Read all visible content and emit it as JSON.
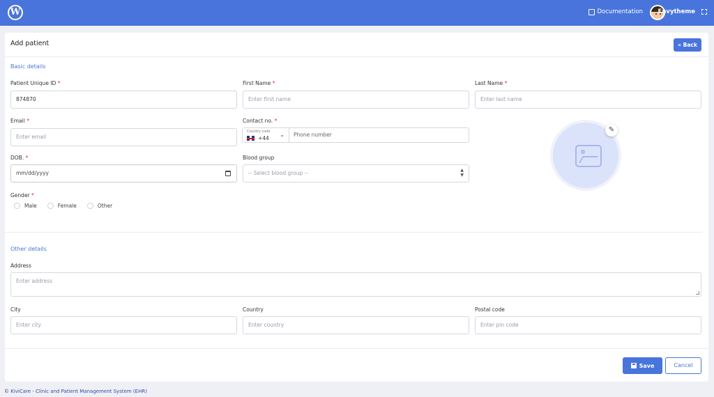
{
  "topbar": {
    "logo_text": "W",
    "documentation_label": "Documentation",
    "username": "Envytheme"
  },
  "card": {
    "title": "Add patient",
    "back_label": "Back"
  },
  "basic": {
    "section_title": "Basic details",
    "patient_id": {
      "label": "Patient Unique ID",
      "value": "874870"
    },
    "first_name": {
      "label": "First Name",
      "placeholder": "Enter first name"
    },
    "last_name": {
      "label": "Last Name",
      "placeholder": "Enter last name"
    },
    "email": {
      "label": "Email",
      "placeholder": "Enter email"
    },
    "contact": {
      "label": "Contact no.",
      "country_code_caption": "Country code",
      "country_code": "+44",
      "phone_placeholder": "Phone number"
    },
    "dob": {
      "label": "DOB.",
      "placeholder": "mm/dd/yyyy"
    },
    "blood_group": {
      "label": "Blood group",
      "placeholder": "-- Select blood group --"
    },
    "gender": {
      "label": "Gender",
      "options": [
        "Male",
        "Female",
        "Other"
      ]
    }
  },
  "other": {
    "section_title": "Other details",
    "address": {
      "label": "Address",
      "placeholder": "Enter address"
    },
    "city": {
      "label": "City",
      "placeholder": "Enter city"
    },
    "country": {
      "label": "Country",
      "placeholder": "Enter country"
    },
    "postal_code": {
      "label": "Postal code",
      "placeholder": "Enter pin code"
    }
  },
  "actions": {
    "save_label": "Save",
    "cancel_label": "Cancel"
  },
  "footer": {
    "symbol": "©",
    "link_text": "KiviCare - Clinic and Patient Management System (EHR)"
  },
  "colors": {
    "primary": "#4874dc",
    "required": "#e0262f"
  }
}
